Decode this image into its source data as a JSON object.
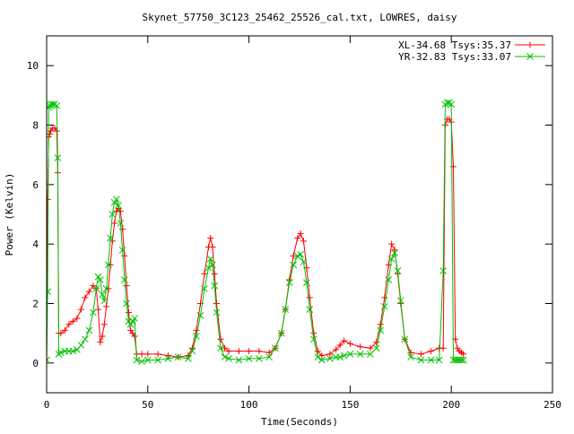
{
  "chart_data": {
    "type": "line",
    "title": "Skynet_57750_3C123_25462_25526_cal.txt, LOWRES, daisy",
    "xlabel": "Time(Seconds)",
    "ylabel": "Power (Kelvin)",
    "xlim": [
      0,
      250
    ],
    "ylim": [
      -1,
      11
    ],
    "xticks": [
      0,
      50,
      100,
      150,
      200,
      250
    ],
    "yticks": [
      0,
      2,
      4,
      6,
      8,
      10
    ],
    "grid": false,
    "legend_position": "top-right",
    "series": [
      {
        "name": "XL-34.68 Tsys:35.37",
        "color": "#ff0000",
        "marker": "plus",
        "x": [
          0,
          0.5,
          1,
          1.5,
          2,
          3,
          4,
          5,
          5.5,
          6,
          7,
          9,
          11,
          13,
          15,
          17,
          19,
          21,
          23,
          24.5,
          25.5,
          26.5,
          27.5,
          28.5,
          29.5,
          30.5,
          31.5,
          32.5,
          33.5,
          34.5,
          35.5,
          36.5,
          37.5,
          38.5,
          39.5,
          40.5,
          41.5,
          42.5,
          43.5,
          44.5,
          47,
          50,
          55,
          60,
          65,
          70,
          72,
          74,
          76,
          78,
          80,
          81,
          82,
          83,
          84,
          86,
          88,
          90,
          95,
          100,
          105,
          110,
          113,
          116,
          118,
          120,
          122,
          124,
          125.5,
          127,
          128.5,
          130,
          132,
          134,
          136,
          140,
          143,
          145,
          147,
          150,
          155,
          160,
          163,
          165,
          167,
          169,
          170.5,
          172,
          173.5,
          175,
          177,
          180,
          185,
          190,
          194,
          196,
          197,
          198,
          199,
          200,
          201,
          202,
          203,
          204,
          205,
          206
        ],
        "y": [
          0,
          5.5,
          7.6,
          7.7,
          7.8,
          7.9,
          7.9,
          7.8,
          6.4,
          1.0,
          1.0,
          1.1,
          1.3,
          1.4,
          1.5,
          1.8,
          2.2,
          2.4,
          2.6,
          2.5,
          1.8,
          0.7,
          0.9,
          1.3,
          1.9,
          2.5,
          3.3,
          4.1,
          4.7,
          5.1,
          5.2,
          5.1,
          4.5,
          3.6,
          2.6,
          1.7,
          1.1,
          1.0,
          0.9,
          0.3,
          0.3,
          0.3,
          0.3,
          0.25,
          0.2,
          0.25,
          0.5,
          1.1,
          2.0,
          3.0,
          3.9,
          4.2,
          3.9,
          3.0,
          2.0,
          0.8,
          0.5,
          0.4,
          0.4,
          0.4,
          0.4,
          0.35,
          0.5,
          1.0,
          1.8,
          2.8,
          3.6,
          4.2,
          4.35,
          4.1,
          3.2,
          2.2,
          1.0,
          0.4,
          0.25,
          0.3,
          0.45,
          0.6,
          0.75,
          0.65,
          0.55,
          0.5,
          0.7,
          1.3,
          2.2,
          3.3,
          4.0,
          3.8,
          3.0,
          2.0,
          0.8,
          0.35,
          0.3,
          0.4,
          0.5,
          0.5,
          8.0,
          8.2,
          8.2,
          8.1,
          6.6,
          0.8,
          0.5,
          0.4,
          0.35,
          0.3
        ]
      },
      {
        "name": "YR-32.83 Tsys:33.07",
        "color": "#00c000",
        "marker": "cross",
        "x": [
          0,
          0.5,
          1,
          1.5,
          2,
          3,
          4,
          5,
          5.5,
          6,
          7,
          9,
          11,
          13,
          15,
          17,
          19,
          21,
          23,
          24.5,
          25.5,
          26.5,
          27.5,
          28.5,
          29.5,
          30.5,
          31.5,
          32.5,
          33.5,
          34.5,
          35.5,
          36.5,
          37.5,
          38.5,
          39.5,
          40.5,
          41.5,
          42.5,
          43.5,
          44.5,
          47,
          50,
          55,
          60,
          65,
          70,
          72,
          74,
          76,
          78,
          80,
          81,
          82,
          83,
          84,
          86,
          88,
          90,
          95,
          100,
          105,
          110,
          113,
          116,
          118,
          120,
          122,
          124,
          125.5,
          127,
          128.5,
          130,
          132,
          134,
          136,
          140,
          143,
          145,
          147,
          150,
          155,
          160,
          163,
          165,
          167,
          169,
          170.5,
          172,
          173.5,
          175,
          177,
          180,
          185,
          190,
          194,
          196,
          197,
          198,
          199,
          200,
          201,
          202,
          203,
          204,
          205,
          206
        ],
        "y": [
          0.1,
          2.4,
          8.6,
          8.65,
          8.7,
          8.7,
          8.7,
          8.65,
          6.9,
          0.3,
          0.35,
          0.4,
          0.4,
          0.4,
          0.45,
          0.6,
          0.8,
          1.1,
          1.7,
          2.5,
          2.9,
          2.8,
          2.3,
          2.1,
          2.5,
          3.3,
          4.2,
          5.0,
          5.4,
          5.5,
          5.3,
          4.7,
          3.8,
          2.8,
          2.0,
          1.4,
          1.3,
          1.4,
          1.5,
          0.1,
          0.05,
          0.1,
          0.1,
          0.15,
          0.2,
          0.15,
          0.4,
          0.9,
          1.6,
          2.5,
          3.2,
          3.5,
          3.3,
          2.6,
          1.7,
          0.5,
          0.2,
          0.15,
          0.1,
          0.15,
          0.15,
          0.2,
          0.5,
          1.0,
          1.8,
          2.7,
          3.3,
          3.6,
          3.65,
          3.4,
          2.7,
          1.8,
          0.8,
          0.2,
          0.1,
          0.15,
          0.2,
          0.2,
          0.25,
          0.3,
          0.3,
          0.3,
          0.5,
          1.1,
          1.9,
          2.8,
          3.5,
          3.7,
          3.1,
          2.1,
          0.8,
          0.2,
          0.1,
          0.1,
          0.1,
          3.1,
          8.7,
          8.75,
          8.75,
          8.7,
          0.1,
          0.1,
          0.1,
          0.1,
          0.1,
          0.1
        ]
      }
    ]
  }
}
